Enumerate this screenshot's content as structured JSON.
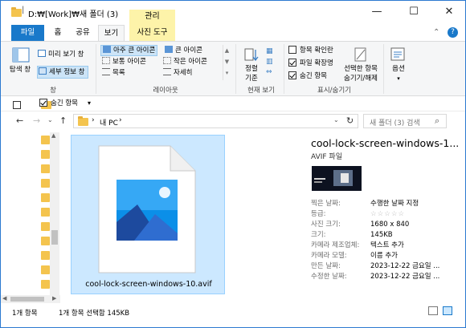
{
  "window": {
    "title": "D:₩[Work]₩새 폴더 (3)",
    "manage_label": "관리",
    "minimize": "—",
    "maximize": "☐",
    "close": "✕"
  },
  "tabs": [
    "파일",
    "홈",
    "공유",
    "보기",
    "사진 도구"
  ],
  "ribbon": {
    "panes": {
      "nav_pane": "탐색 창",
      "preview_pane": "미리 보기 창",
      "details_pane": "세부 정보 창",
      "label": "창"
    },
    "layout": {
      "extra_large": "아주 큰 아이콘",
      "large": "큰 아이콘",
      "medium": "보통 아이콘",
      "small": "작은 아이콘",
      "list": "목록",
      "details": "자세히",
      "label": "레이아웃"
    },
    "current_view": {
      "sort": "정렬",
      "sort2": "기준",
      "label": "현재 보기"
    },
    "show_hide": {
      "item_checkboxes": "항목 확인란",
      "file_extensions": "파일 확장명",
      "hidden_items": "숨긴 항목",
      "hide_selected": "선택한 항목",
      "hide_selected2": "숨기기/해제",
      "label": "표시/숨기기"
    },
    "options": "옵션",
    "group_label_options": ""
  },
  "qat": {
    "hidden_items": "숨긴 항목",
    "dropdown": "▾"
  },
  "address": {
    "breadcrumb_pc": "내 PC",
    "separator": "›",
    "search_placeholder": "새 폴더 (3) 검색"
  },
  "file": {
    "name": "cool-lock-screen-windows-10.avif"
  },
  "details": {
    "title": "cool-lock-screen-windows-1...",
    "type": "AVIF 파일",
    "rows": [
      {
        "key": "찍은 날짜:",
        "value": "수행한 날짜 지정"
      },
      {
        "key": "등급:",
        "value": "☆☆☆☆☆"
      },
      {
        "key": "사진 크기:",
        "value": "1680 x 840"
      },
      {
        "key": "크기:",
        "value": "145KB"
      },
      {
        "key": "카메라 제조업체:",
        "value": "텍스트 추가"
      },
      {
        "key": "카메라 모델:",
        "value": "이름 추가"
      },
      {
        "key": "만든 날짜:",
        "value": "2023-12-22 금요일 ..."
      },
      {
        "key": "수정한 날짜:",
        "value": "2023-12-22 금요일 ..."
      }
    ]
  },
  "status": {
    "count": "1개 항목",
    "selected": "1개 항목 선택함 145KB"
  },
  "colors": {
    "accent": "#1979ca",
    "selection": "#cce8ff",
    "manage": "#fdf3a9"
  }
}
